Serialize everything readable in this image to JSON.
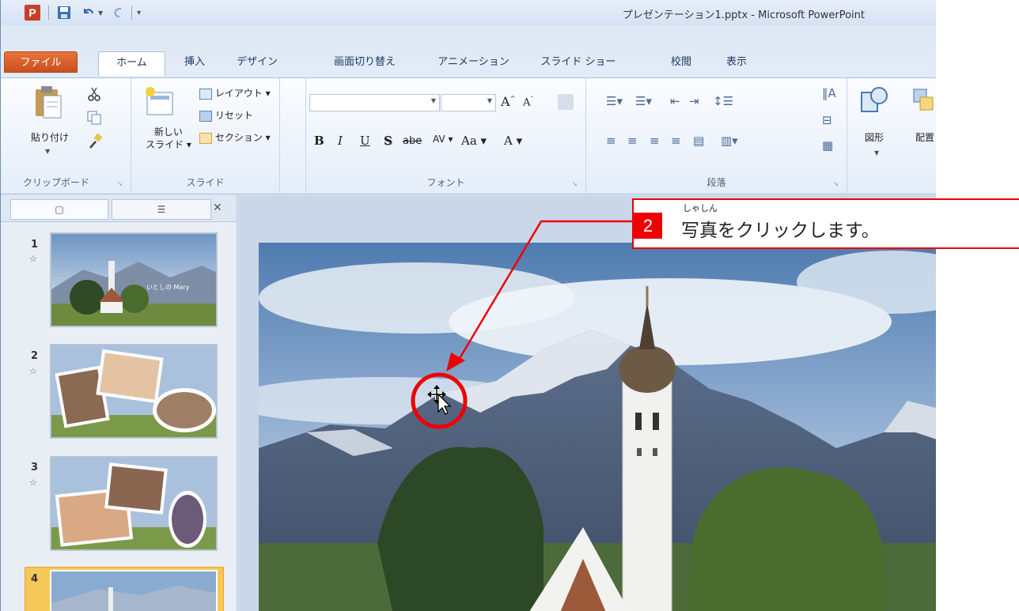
{
  "window": {
    "title": "プレゼンテーション1.pptx - Microsoft PowerPoint",
    "app_icon": "P"
  },
  "ribbon_tabs": [
    {
      "label": "ファイル"
    },
    {
      "label": "ホーム"
    },
    {
      "label": "挿入"
    },
    {
      "label": "デザイン"
    },
    {
      "label": "画面切り替え"
    },
    {
      "label": "アニメーション"
    },
    {
      "label": "スライド ショー"
    },
    {
      "label": "校閲"
    },
    {
      "label": "表示"
    }
  ],
  "ribbon": {
    "clipboard": {
      "paste": "貼り付け",
      "group": "クリップボード"
    },
    "slides": {
      "new_slide_1": "新しい",
      "new_slide_2": "スライド",
      "layout": "レイアウト",
      "reset": "リセット",
      "section": "セクション",
      "group": "スライド"
    },
    "font": {
      "group": "フォント",
      "bold": "B",
      "italic": "I",
      "underline": "U",
      "shadow": "S",
      "strike": "abe",
      "spacing": "AV",
      "case": "Aa",
      "color": "A",
      "grow": "A",
      "shrink": "A"
    },
    "paragraph": {
      "group": "段落"
    },
    "drawing": {
      "shapes": "図形",
      "arrange": "配置"
    }
  },
  "slides": [
    {
      "number": "1",
      "marker": "☆",
      "caption": "いとしの Mary"
    },
    {
      "number": "2",
      "marker": "☆"
    },
    {
      "number": "3",
      "marker": "☆"
    },
    {
      "number": "4"
    }
  ],
  "callout": {
    "step": "2",
    "text": "写真をクリックします。",
    "ruby": "しゃしん"
  },
  "colors": {
    "accent": "#e00000",
    "file_tab": "#d4592a",
    "selected_slide": "#f6c85a"
  }
}
